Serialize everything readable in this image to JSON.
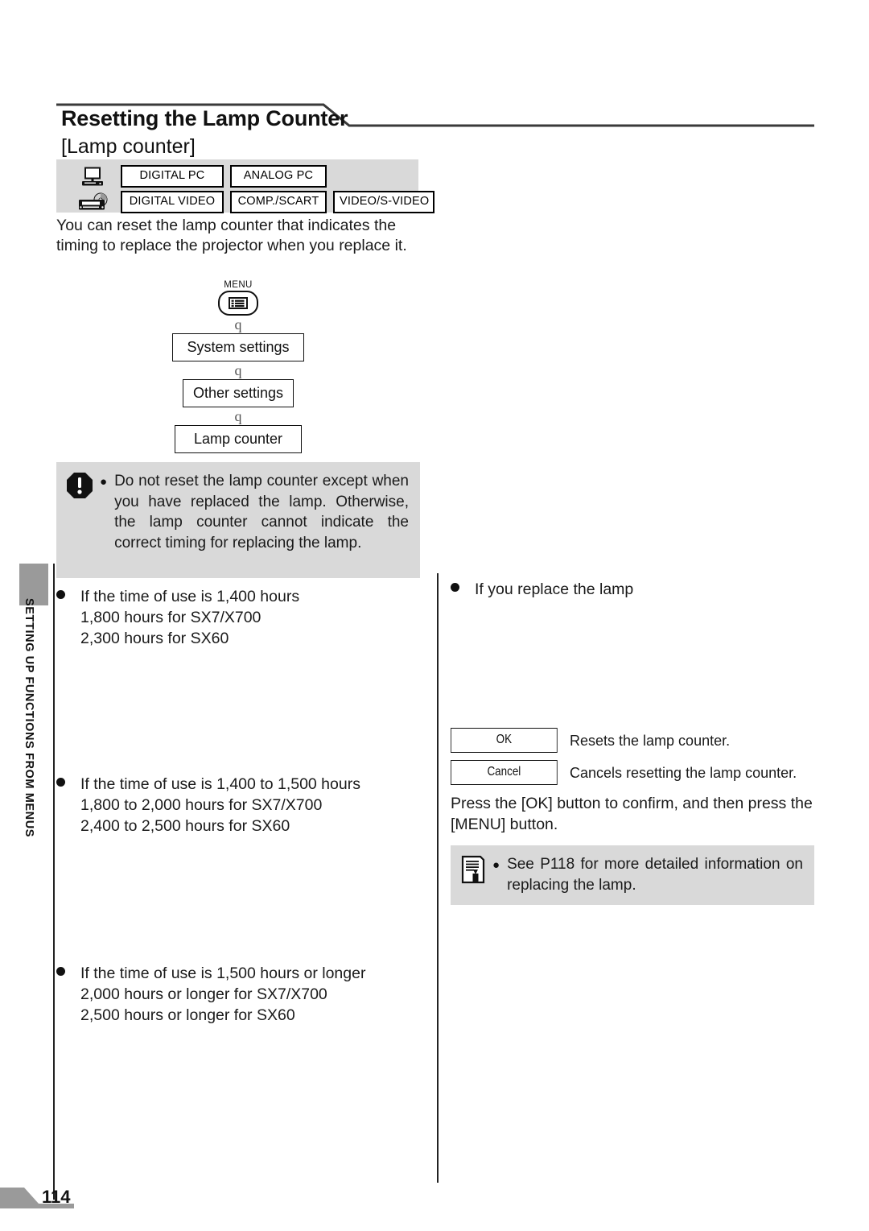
{
  "page": {
    "number": "114",
    "side_tab_label": "SETTING UP FUNCTIONS FROM MENUS"
  },
  "header": {
    "title": "Resetting the Lamp Counter",
    "subtitle": "[Lamp counter]"
  },
  "signal_types": {
    "row1": {
      "icon": "computer-icon",
      "badges": [
        "DIGITAL PC",
        "ANALOG PC"
      ]
    },
    "row2": {
      "icon": "video-player-icon",
      "badges": [
        "DIGITAL VIDEO",
        "COMP./SCART",
        "VIDEO/S-VIDEO"
      ]
    }
  },
  "intro": "You can reset the lamp counter that indicates the timing to replace the projector when you replace it.",
  "flow": {
    "menu_label": "MENU",
    "menu_icon": "menu-list-icon",
    "arrow_glyph": "q",
    "steps": [
      "System settings",
      "Other settings",
      "Lamp counter"
    ]
  },
  "caution": {
    "icon": "warning-octagon-icon",
    "bullet": "●",
    "text": "Do not reset the lamp counter except when you have replaced the lamp. Otherwise, the lamp counter cannot indicate the correct timing for replacing the lamp."
  },
  "cases": [
    {
      "heading": "If the time of use is 1,400 hours",
      "lines": [
        "1,800 hours for SX7/X700",
        "2,300 hours for SX60"
      ]
    },
    {
      "heading": "If the time of use is 1,400 to 1,500 hours",
      "lines": [
        "1,800 to 2,000 hours for SX7/X700",
        "2,400 to 2,500 hours for SX60"
      ]
    },
    {
      "heading": "If the time of use is 1,500 hours or longer",
      "lines": [
        "2,000 hours or longer for SX7/X700",
        "2,500 hours or longer for SX60"
      ]
    }
  ],
  "replace": {
    "heading": "If you replace the lamp",
    "buttons": [
      {
        "label": "OK",
        "description": "Resets the lamp counter."
      },
      {
        "label": "Cancel",
        "description": "Cancels resetting the lamp counter."
      }
    ],
    "confirm_text": "Press the [OK] button to confirm, and then press the [MENU] button."
  },
  "note": {
    "icon": "memo-pencil-icon",
    "bullet": "●",
    "text": "See P118 for more detailed information on replacing the lamp."
  },
  "colors": {
    "band_gray": "#d9d9d9",
    "tab_gray": "#9a9a9a",
    "ink": "#1a1a1a"
  }
}
